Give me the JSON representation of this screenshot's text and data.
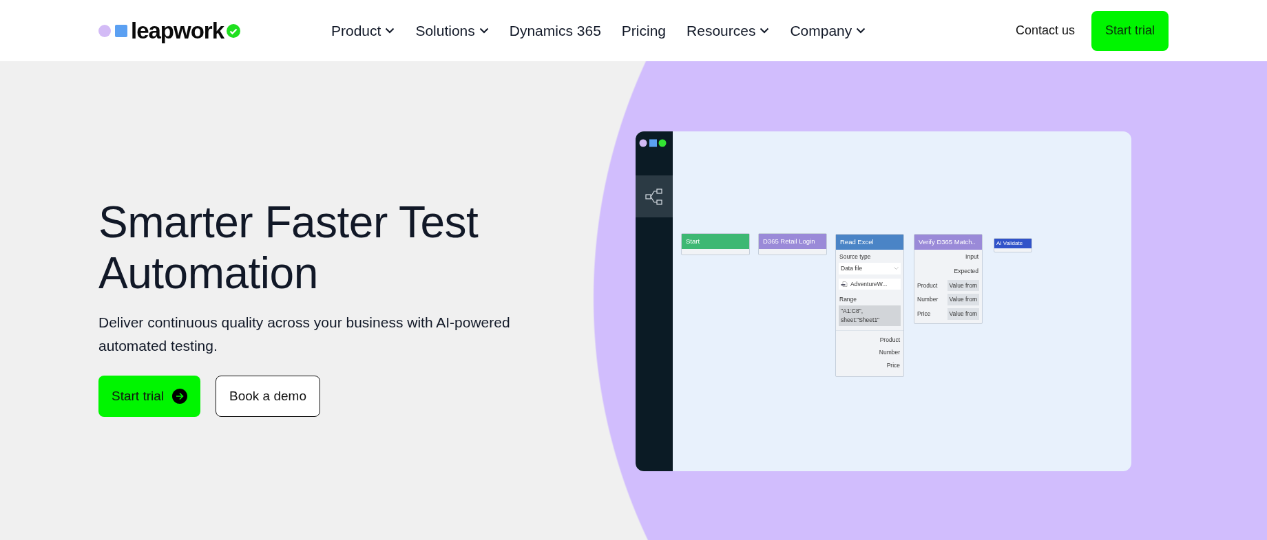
{
  "header": {
    "logo": {
      "text": "leapwork"
    },
    "nav": [
      {
        "label": "Product",
        "dropdown": true
      },
      {
        "label": "Solutions",
        "dropdown": true
      },
      {
        "label": "Dynamics 365",
        "dropdown": false
      },
      {
        "label": "Pricing",
        "dropdown": false
      },
      {
        "label": "Resources",
        "dropdown": true
      },
      {
        "label": "Company",
        "dropdown": true
      }
    ],
    "contact": "Contact us",
    "cta": "Start trial"
  },
  "hero": {
    "title": "Smarter Faster Test Automation",
    "subtitle": "Deliver continuous quality across your business with AI-powered automated testing.",
    "buttons": [
      {
        "label": "Start trial",
        "kind": "primary"
      },
      {
        "label": "Book a demo",
        "kind": "outline"
      }
    ]
  },
  "app_preview": {
    "nodes": [
      {
        "title": "Start",
        "color": "#3db873",
        "kind": "simple"
      },
      {
        "title": "D365 Retail Login",
        "color": "#9a8ad8",
        "kind": "simple"
      },
      {
        "title": "Read Excel",
        "color": "#4a84c6",
        "kind": "excel",
        "source_label": "Source type",
        "source_value": "Data file",
        "file": "AdventureW...",
        "range_label": "Range",
        "range_value": "\"A1:C8\", sheet:\"Sheet1\"",
        "outputs": [
          "Product",
          "Number",
          "Price"
        ]
      },
      {
        "title": "Verify D365 Match..",
        "color": "#9a8ad8",
        "kind": "verify",
        "inputs": [
          "Input",
          "Expected"
        ],
        "rows": [
          {
            "label": "Product",
            "value": "Value from"
          },
          {
            "label": "Number",
            "value": "Value from"
          },
          {
            "label": "Price",
            "value": "Value from"
          }
        ]
      },
      {
        "title": "AI Validate",
        "color": "#3153c9",
        "kind": "tiny"
      }
    ]
  }
}
